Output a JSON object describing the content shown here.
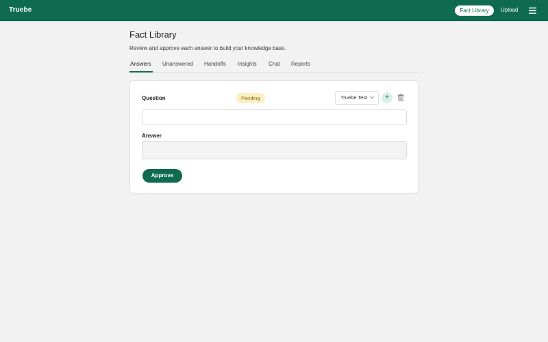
{
  "app": {
    "brand": "Truebe"
  },
  "nav": {
    "fact_library": "Fact Library",
    "upload": "Upload",
    "menu_icon": "hamburger-menu-icon"
  },
  "header": {
    "title": "Fact Library",
    "subtitle": "Review and approve each answer to build your knowledge base."
  },
  "tabs": {
    "active": "Answers",
    "items": [
      {
        "label": "Answers"
      },
      {
        "label": "Unanswered"
      },
      {
        "label": "Handoffs"
      },
      {
        "label": "Insights"
      },
      {
        "label": "Chat"
      },
      {
        "label": "Reports"
      }
    ]
  },
  "card": {
    "question_label": "Question",
    "status": "Pending",
    "workspace": "Truebe Test",
    "add_symbol": "+",
    "question_value": "",
    "answer_label": "Answer",
    "answer_value": "",
    "approve_label": "Approve"
  },
  "colors": {
    "brand": "#0e6b4f",
    "page_bg": "#f2f2f2",
    "pending_bg": "#fbefc4",
    "pending_text": "#8a6a10"
  },
  "icons": {
    "menu": "hamburger-menu-icon",
    "chevron": "chevron-down-icon",
    "add": "plus-icon",
    "delete": "trash-icon"
  }
}
